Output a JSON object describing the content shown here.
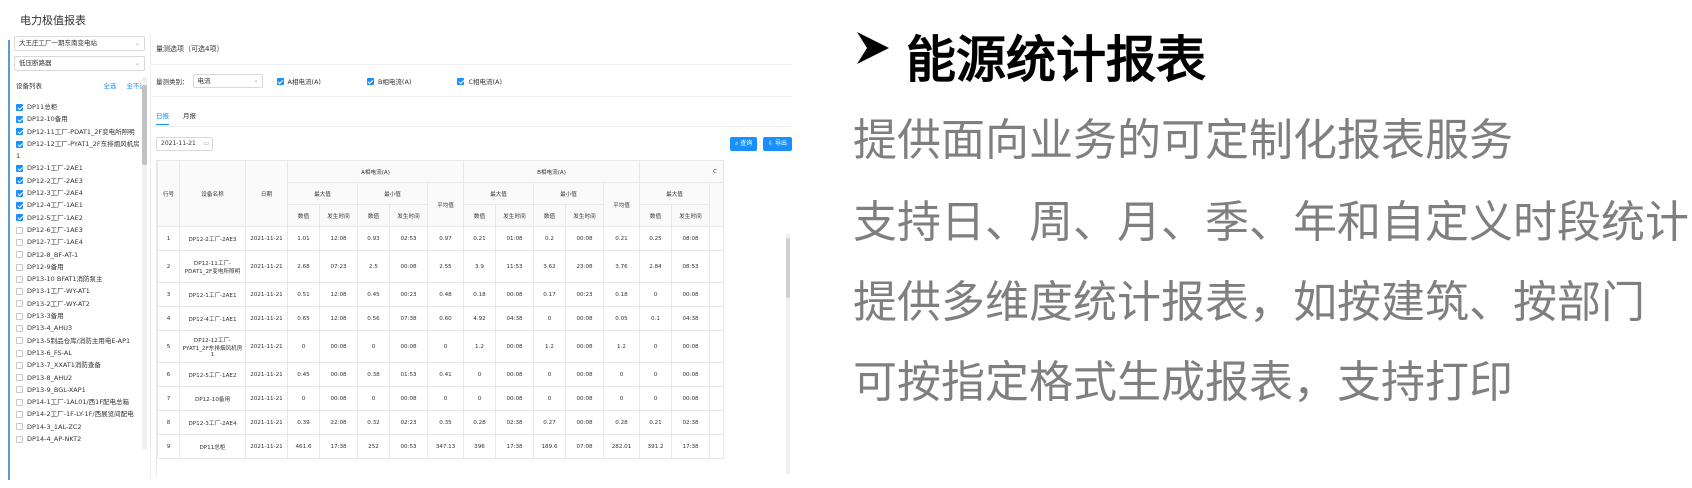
{
  "app": {
    "title": "电力极值报表",
    "station_select": "大王庄工厂一期东南变电站",
    "level_select": "低压断路器",
    "device_list_label": "设备列表",
    "select_all": "全选",
    "select_none": "全不选",
    "devices": [
      {
        "label": "DP11总柜",
        "checked": true
      },
      {
        "label": "DP12-10备用",
        "checked": true
      },
      {
        "label": "DP12-11工厂-PDAT1_2F变电所照明",
        "checked": true
      },
      {
        "label": "DP12-12工厂-PYAT1_2F东排烟风机房",
        "checked": true
      },
      {
        "label": "1",
        "checked": false,
        "continuation": true
      },
      {
        "label": "DP12-1工厂-2AE1",
        "checked": true
      },
      {
        "label": "DP12-2工厂-2AE3",
        "checked": true
      },
      {
        "label": "DP12-3工厂-2AE4",
        "checked": true
      },
      {
        "label": "DP12-4工厂-1AE1",
        "checked": true
      },
      {
        "label": "DP12-5工厂-1AE2",
        "checked": true
      },
      {
        "label": "DP12-6工厂-1AE3",
        "checked": false
      },
      {
        "label": "DP12-7工厂-1AE4",
        "checked": false
      },
      {
        "label": "DP12-8_BF-AT-1",
        "checked": false
      },
      {
        "label": "DP12-9备用",
        "checked": false
      },
      {
        "label": "DP13-10 BFAT1消防泵主",
        "checked": false
      },
      {
        "label": "DP13-1工厂-WY-AT1",
        "checked": false
      },
      {
        "label": "DP13-2工厂-WY-AT2",
        "checked": false
      },
      {
        "label": "DP13-3备用",
        "checked": false
      },
      {
        "label": "DP13-4_AHU3",
        "checked": false
      },
      {
        "label": "DP13-5制品仓库/消防主用电E-AP1",
        "checked": false
      },
      {
        "label": "DP13-6_FS-AL",
        "checked": false
      },
      {
        "label": "DP13-7_XXAT1消防查备",
        "checked": false
      },
      {
        "label": "DP13-8_AHU2",
        "checked": false
      },
      {
        "label": "DP13-9_BGL-XAP1",
        "checked": false
      },
      {
        "label": "DP14-1工厂-1AL01/西1F配电总箱",
        "checked": false
      },
      {
        "label": "DP14-2工厂-1F-LY-1F/西展览间配电",
        "checked": false
      },
      {
        "label": "DP14-3_1AL-ZC2",
        "checked": false
      },
      {
        "label": "DP14-4_AP-NKT2",
        "checked": false
      }
    ],
    "measure_title": "量测选项（可选4项）",
    "measure_type_label": "量测类别：",
    "measure_type_value": "电流",
    "phase_a": "A相电流(A)",
    "phase_b": "B相电流(A)",
    "phase_c": "C相电流(A)",
    "tabs": [
      {
        "label": "日报",
        "active": true
      },
      {
        "label": "月报",
        "active": false
      }
    ],
    "date_value": "2021-11-21",
    "query_label": "查询",
    "export_label": "导出",
    "table": {
      "h_index": "行号",
      "h_device": "设备名称",
      "h_date": "日期",
      "group_a": "A相电流(A)",
      "group_b": "B相电流(A)",
      "group_c": "C",
      "h_max": "最大值",
      "h_min": "最小值",
      "h_avg": "平均值",
      "h_value": "数值",
      "h_time": "发生时间",
      "rows": [
        [
          "1",
          "DP12-2工厂-2AE3",
          "2021-11-21",
          "1.01",
          "12:08",
          "0.93",
          "02:53",
          "0.97",
          "0.21",
          "01:08",
          "0.2",
          "00:08",
          "0.21",
          "0.25",
          "08:08"
        ],
        [
          "2",
          "DP12-11工厂-PDAT1_2F变电所照明",
          "2021-11-21",
          "2.68",
          "07:23",
          "2.5",
          "00:08",
          "2.55",
          "3.9",
          "11:53",
          "3.62",
          "23:08",
          "3.76",
          "2.84",
          "08:53"
        ],
        [
          "3",
          "DP12-1工厂-2AE1",
          "2021-11-21",
          "0.51",
          "12:08",
          "0.45",
          "00:23",
          "0.48",
          "0.18",
          "00:08",
          "0.17",
          "00:23",
          "0.18",
          "0",
          "00:08"
        ],
        [
          "4",
          "DP12-4工厂-1AE1",
          "2021-11-21",
          "0.65",
          "12:08",
          "0.56",
          "07:38",
          "0.60",
          "4.92",
          "04:38",
          "0",
          "00:08",
          "0.05",
          "0.1",
          "04:38"
        ],
        [
          "5",
          "DP12-12工厂-PYAT1_2F东排烟风机房1",
          "2021-11-21",
          "0",
          "00:08",
          "0",
          "00:08",
          "0",
          "1.2",
          "00:08",
          "1.2",
          "00:08",
          "1.2",
          "0",
          "00:08"
        ],
        [
          "6",
          "DP12-5工厂-1AE2",
          "2021-11-21",
          "0.45",
          "00:08",
          "0.38",
          "01:53",
          "0.41",
          "0",
          "00:08",
          "0",
          "00:08",
          "0",
          "0",
          "00:08"
        ],
        [
          "7",
          "DP12-10备用",
          "2021-11-21",
          "0",
          "00:08",
          "0",
          "00:08",
          "0",
          "0",
          "00:08",
          "0",
          "00:08",
          "0",
          "0",
          "00:08"
        ],
        [
          "8",
          "DP12-3工厂-2AE4",
          "2021-11-21",
          "0.39",
          "22:08",
          "0.32",
          "02:23",
          "0.35",
          "0.28",
          "02:38",
          "0.27",
          "00:08",
          "0.28",
          "0.21",
          "02:38"
        ],
        [
          "9",
          "DP11总柜",
          "2021-11-21",
          "461.6",
          "17:38",
          "252",
          "00:53",
          "347.13",
          "396",
          "17:38",
          "189.6",
          "07:08",
          "282.01",
          "391.2",
          "17:38"
        ]
      ]
    }
  },
  "feature": {
    "title": "能源统计报表",
    "items": [
      "提供面向业务的可定制化报表服务",
      "支持日、周、月、季、年和自定义时段统计",
      "提供多维度统计报表，如按建筑、按部门",
      "可按指定格式生成报表，支持打印"
    ]
  },
  "icons": {
    "arrow": "arrow-right-icon",
    "check": "checkbox-icon",
    "calendar": "calendar-icon",
    "search": "search-icon",
    "export": "export-icon"
  },
  "colors": {
    "accent": "#1890ff",
    "feature_text": "#7f7f7f",
    "title_text": "#000000"
  }
}
